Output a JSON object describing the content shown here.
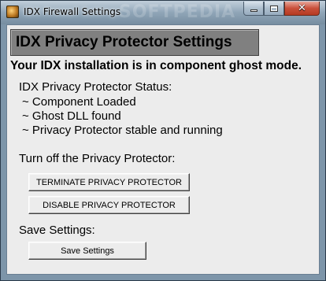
{
  "window": {
    "title": "IDX Firewall Settings",
    "watermark": "SOFTPEDIA",
    "close_glyph": "✕",
    "app_icon": "app-icon",
    "accent_close": "#c9503a"
  },
  "content": {
    "header": "IDX Privacy Protector Settings",
    "ghost_mode": "Your IDX installation is in component ghost mode.",
    "status_heading": "IDX Privacy Protector Status:",
    "status_lines": [
      "~ Component Loaded",
      "~ Ghost DLL found",
      "~ Privacy Protector stable and running"
    ],
    "turn_off_label": "Turn off the Privacy Protector:",
    "terminate_button": "TERMINATE PRIVACY PROTECTOR",
    "disable_button": "DISABLE PRIVACY PROTECTOR",
    "save_label": "Save Settings:",
    "save_button": "Save Settings"
  }
}
